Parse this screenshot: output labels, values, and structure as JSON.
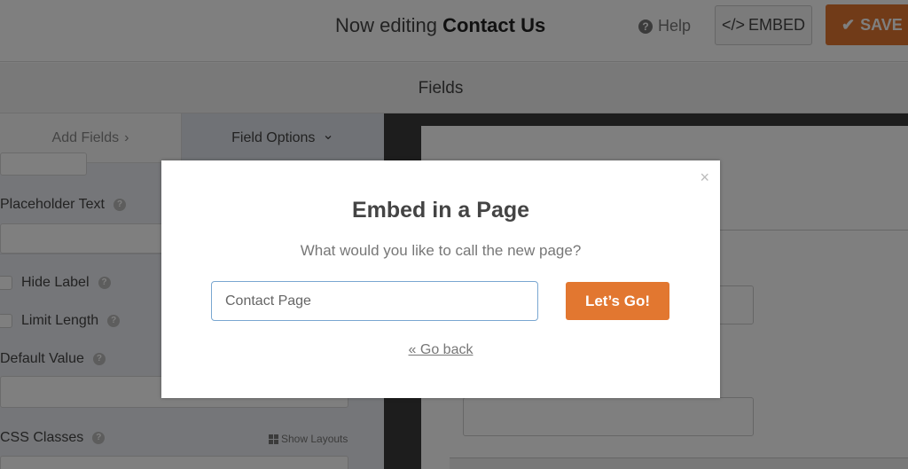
{
  "topbar": {
    "title_prefix": "Now editing",
    "title_form": "Contact Us",
    "help_label": "Help",
    "embed_icon": "</>",
    "embed_label": "EMBED",
    "save_icon": "✔",
    "save_label": "SAVE"
  },
  "fields_bar": {
    "label": "Fields"
  },
  "sidebar": {
    "tabs": [
      {
        "label": "Add Fields",
        "icon": "›",
        "icon_name": "chevron-right-icon"
      },
      {
        "label": "Field Options",
        "icon": "⌄",
        "icon_name": "chevron-down-icon"
      }
    ],
    "options": {
      "placeholder_text": "Placeholder Text",
      "hide_label": "Hide Label",
      "limit_length": "Limit Length",
      "default_value": "Default Value",
      "css_classes": "CSS Classes",
      "show_layouts": "Show Layouts"
    },
    "help_glyph": "?"
  },
  "modal": {
    "title": "Embed in a Page",
    "subtitle": "What would you like to call the new page?",
    "input_value": "Contact Page",
    "submit_label": "Let’s Go!",
    "back_label": "« Go back",
    "close_glyph": "×"
  },
  "colors": {
    "accent_orange": "#e27730",
    "input_focus_border": "#7aa7d1"
  }
}
